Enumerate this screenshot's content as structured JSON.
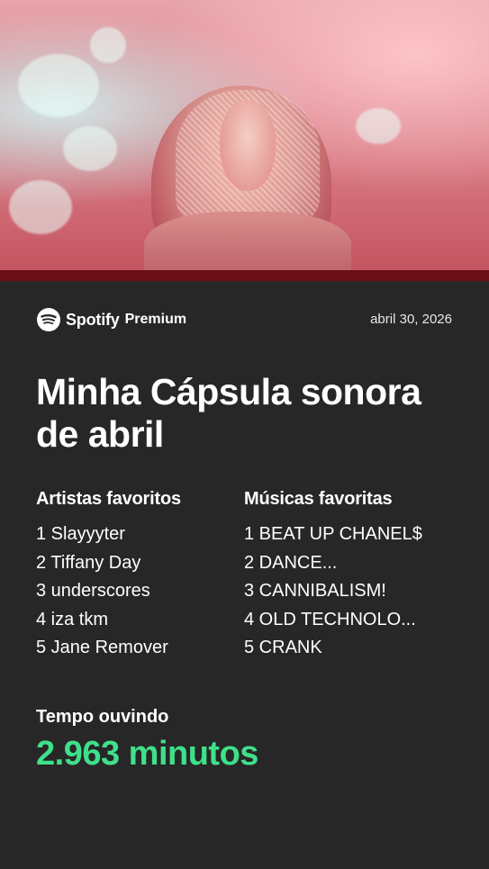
{
  "header": {
    "brand": "Spotify",
    "tier": "Premium",
    "date": "abril 30, 2026"
  },
  "title": "Minha Cápsula sonora de abril",
  "artists": {
    "heading": "Artistas favoritos",
    "items": [
      "1 Slayyyter",
      "2 Tiffany Day",
      "3 underscores",
      "4 iza tkm",
      "5 Jane Remover"
    ]
  },
  "songs": {
    "heading": "Músicas favoritas",
    "items": [
      "1 BEAT UP CHANEL$",
      "2 DANCE...",
      "3 CANNIBALISM!",
      "4 OLD TECHNOLO...",
      "5 CRANK"
    ]
  },
  "listening": {
    "label": "Tempo ouvindo",
    "value": "2.963 minutos"
  },
  "colors": {
    "background": "#272727",
    "accent_green": "#3fe08a",
    "hero_bar": "#6a0f17"
  },
  "icons": {
    "logo": "spotify-logo-icon"
  }
}
